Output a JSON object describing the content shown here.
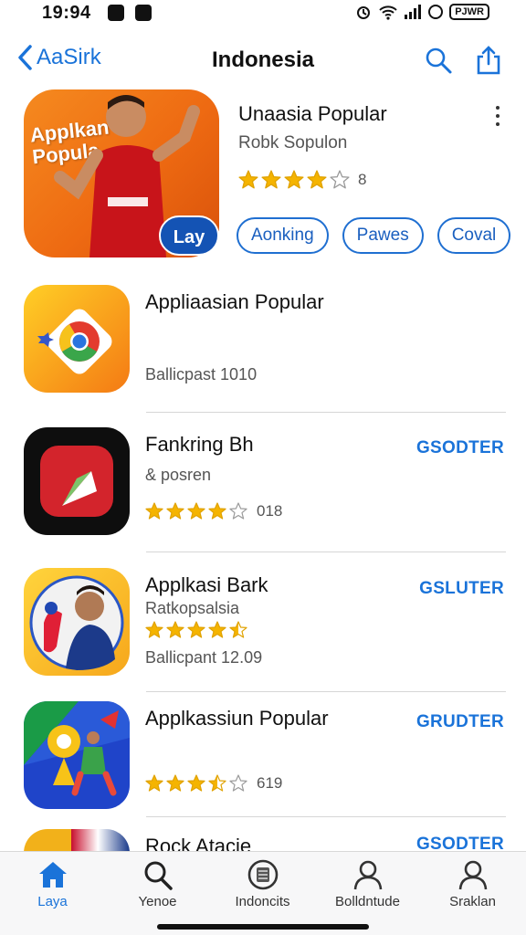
{
  "status": {
    "time": "19:94",
    "battery": "PJWR"
  },
  "nav": {
    "back_label": "AaSirk",
    "title": "Indonesia"
  },
  "featured": {
    "art_text_line1": "Applkan",
    "art_text_line2": "Popula",
    "get_label": "Lay",
    "title": "Unaasia Popular",
    "subtitle": "Robk Sopulon",
    "rating_stars": 4,
    "rating_count": "8",
    "chips": [
      "Aonking",
      "Pawes",
      "Coval"
    ]
  },
  "apps": [
    {
      "name": "Appliaasian Popular",
      "line1": "",
      "stars": null,
      "count": "",
      "line2": "Ballicpast 1010",
      "action": ""
    },
    {
      "name": "Fankring Bh",
      "line1": "& posren",
      "stars": 4,
      "count": "018",
      "line2": "",
      "action": "GSODTER"
    },
    {
      "name": "Applkasi Bark",
      "line1": "Ratkopsalsia",
      "stars": 4.5,
      "count": "",
      "line2": "Ballicpant 12.09",
      "action": "GSLUTER"
    },
    {
      "name": "Applkassiun Popular",
      "line1": "",
      "stars": 3.5,
      "count": "619",
      "line2": "",
      "action": "GRUDTER"
    },
    {
      "name": "Rock Atacie",
      "line1": "",
      "stars": null,
      "count": "",
      "line2": "",
      "action": "GSODTER"
    }
  ],
  "tabs": [
    {
      "label": "Laya",
      "icon": "home-icon",
      "active": true
    },
    {
      "label": "Yenoe",
      "icon": "search-icon",
      "active": false
    },
    {
      "label": "Indoncits",
      "icon": "store-icon",
      "active": false
    },
    {
      "label": "Bolldntude",
      "icon": "person-icon",
      "active": false
    },
    {
      "label": "Sraklan",
      "icon": "person-icon",
      "active": false
    }
  ],
  "colors": {
    "accent": "#1a73d9",
    "star": "#f5b400",
    "get_button": "#1453b4"
  }
}
